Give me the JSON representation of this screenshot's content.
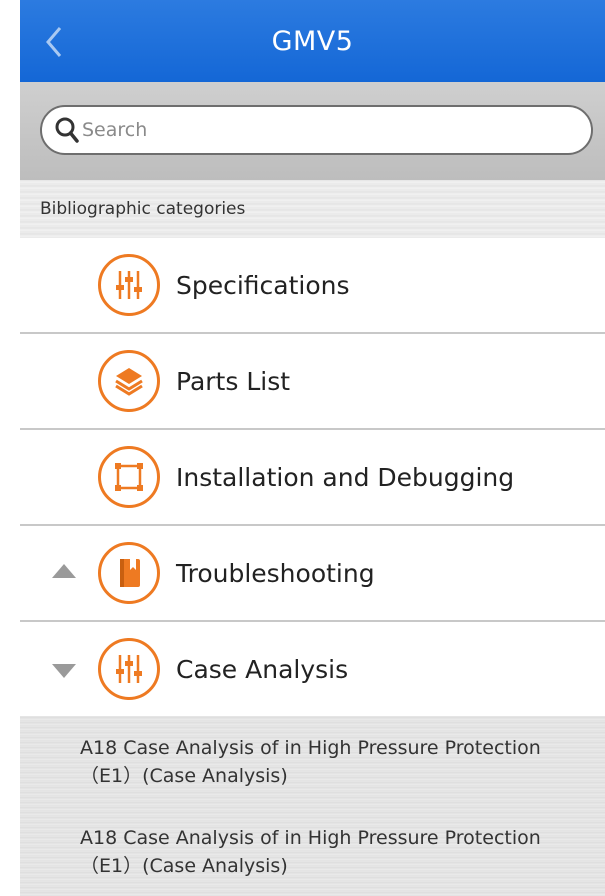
{
  "header": {
    "title": "GMV5"
  },
  "search": {
    "placeholder": "Search"
  },
  "section": {
    "title": "Bibliographic categories"
  },
  "categories": [
    {
      "label": "Specifications",
      "icon": "sliders-icon",
      "arrow": "none"
    },
    {
      "label": "Parts List",
      "icon": "layers-icon",
      "arrow": "none"
    },
    {
      "label": "Installation and Debugging",
      "icon": "frame-icon",
      "arrow": "none"
    },
    {
      "label": "Troubleshooting",
      "icon": "book-icon",
      "arrow": "up"
    },
    {
      "label": "Case Analysis",
      "icon": "sliders-icon",
      "arrow": "down"
    }
  ],
  "sub_items": [
    {
      "line1": "A18 Case Analysis of in High Pressure Protection",
      "line2": "（E1）(Case Analysis)"
    },
    {
      "line1": "A18 Case Analysis of in High Pressure Protection",
      "line2": "（E1）(Case Analysis)"
    }
  ],
  "colors": {
    "header_blue": "#1467d6",
    "accent_orange": "#ee7a22"
  }
}
